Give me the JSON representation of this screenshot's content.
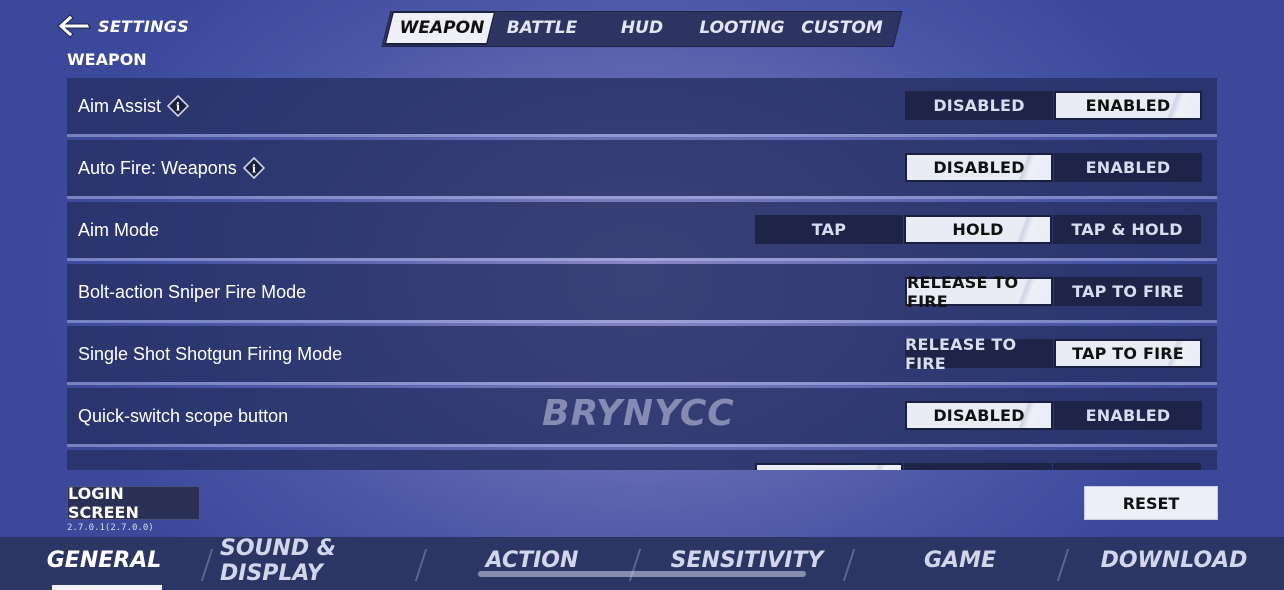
{
  "header": {
    "back_label": "SETTINGS",
    "tabs": [
      "WEAPON",
      "BATTLE",
      "HUD",
      "LOOTING",
      "CUSTOM"
    ],
    "active_tab": "WEAPON"
  },
  "section_title": "WEAPON",
  "settings": [
    {
      "label": "Aim Assist",
      "info": true,
      "options": [
        "DISABLED",
        "ENABLED"
      ],
      "selected": "ENABLED"
    },
    {
      "label": "Auto Fire: Weapons",
      "info": true,
      "options": [
        "DISABLED",
        "ENABLED"
      ],
      "selected": "DISABLED"
    },
    {
      "label": "Aim Mode",
      "info": false,
      "options": [
        "TAP",
        "HOLD",
        "TAP & HOLD"
      ],
      "selected": "HOLD"
    },
    {
      "label": "Bolt-action Sniper Fire Mode",
      "info": false,
      "options": [
        "RELEASE TO FIRE",
        "TAP TO FIRE"
      ],
      "selected": "RELEASE TO FIRE"
    },
    {
      "label": "Single Shot Shotgun Firing Mode",
      "info": false,
      "options": [
        "RELEASE TO FIRE",
        "TAP TO FIRE"
      ],
      "selected": "TAP TO FIRE"
    },
    {
      "label": "Quick-switch scope button",
      "info": false,
      "options": [
        "DISABLED",
        "ENABLED"
      ],
      "selected": "DISABLED"
    }
  ],
  "watermark": "BRYNYCC",
  "footer": {
    "login_label": "LOGIN SCREEN",
    "version": "2.7.0.1(2.7.0.0)",
    "reset_label": "RESET"
  },
  "bottom_nav": {
    "items": [
      "GENERAL",
      "SOUND & DISPLAY",
      "ACTION",
      "SENSITIVITY",
      "GAME",
      "DOWNLOAD"
    ],
    "active": "GENERAL"
  },
  "colors": {
    "background": "#5a63ad",
    "row": "#263063",
    "option": "#1e2447",
    "selected": "#e9ecf5"
  }
}
